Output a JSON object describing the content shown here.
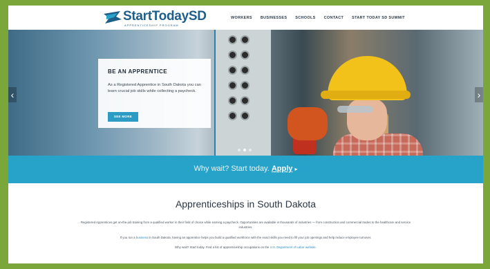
{
  "logo": {
    "name": "StartTodaySD",
    "tagline": "APPRENTICESHIP PROGRAM"
  },
  "nav": [
    "WORKERS",
    "BUSINESSES",
    "SCHOOLS",
    "CONTACT",
    "START TODAY SD SUMMIT"
  ],
  "hero": {
    "card_title": "BE AN APPRENTICE",
    "card_text": "As a Registered Apprentice in South Dakota you can learn crucial job skills while collecting a paycheck.",
    "button": "SEE MORE",
    "prev_arrow": "‹",
    "next_arrow": "›",
    "slides": 3,
    "active_slide": 2
  },
  "cta": {
    "text": "Why wait? Start today.",
    "link": "Apply",
    "arrow": "▸"
  },
  "content": {
    "heading": "Apprenticeships in South Dakota",
    "p1": "Registered Apprentices get on-the-job training from a qualified worker in their field of choice while earning a paycheck. Opportunities are available in thousands of industries — from construction and commercial trades to the healthcare and service industries.",
    "p2_before": "If you run a",
    "p2_link": "business",
    "p2_after": "in South Dakota, having an apprentice helps you build a qualified workforce with the exact skills you need to fill your job openings and help reduce employee turnover.",
    "p3_before": "Why wait? Start today. Find a list of apprenticeship occupations on the",
    "p3_link": "U.S. Department of Labor website."
  },
  "colors": {
    "frame": "#7aa63a",
    "accent": "#27a3c9",
    "brand": "#1e5f8a"
  }
}
